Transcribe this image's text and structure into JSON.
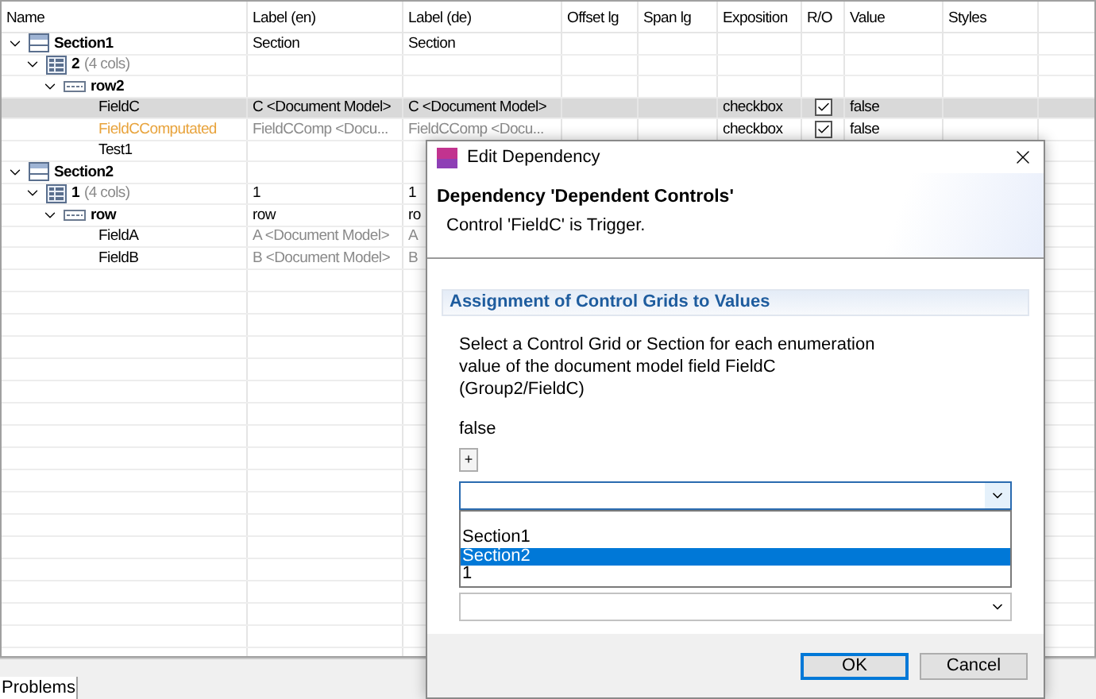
{
  "table": {
    "columns": [
      "Name",
      "Label (en)",
      "Label (de)",
      "Offset lg",
      "Span lg",
      "Exposition",
      "R/O",
      "Value",
      "Styles"
    ],
    "rows": [
      {
        "kind": "section",
        "name": "Section1",
        "expanded": true,
        "selected": false,
        "label_en": "Section",
        "label_de": "Section",
        "children": [
          {
            "kind": "grid",
            "name": "2",
            "count": "(4 cols)",
            "expanded": true,
            "selected": false,
            "children": [
              {
                "kind": "row",
                "name": "row2",
                "expanded": true,
                "selected": false,
                "children": [
                  {
                    "kind": "field",
                    "name": "FieldC",
                    "computed": false,
                    "selected": true,
                    "label_en": "C <Document Model>",
                    "label_de": "C <Document Model>",
                    "exposition": "checkbox",
                    "read_only": true,
                    "value": "false"
                  },
                  {
                    "kind": "field",
                    "name": "FieldCComputated",
                    "computed": true,
                    "selected": false,
                    "label_en": "FieldCComp <Docu...",
                    "label_de": "FieldCComp <Docu...",
                    "exposition": "checkbox",
                    "read_only": true,
                    "value": "false"
                  },
                  {
                    "kind": "field",
                    "name": "Test1",
                    "computed": false,
                    "selected": false
                  }
                ]
              }
            ]
          }
        ]
      },
      {
        "kind": "section",
        "name": "Section2",
        "expanded": true,
        "selected": false,
        "children": [
          {
            "kind": "grid",
            "name": "1",
            "count": "(4 cols)",
            "expanded": true,
            "selected": false,
            "label_en": "1",
            "label_de": "1",
            "children": [
              {
                "kind": "row",
                "name": "row",
                "expanded": true,
                "selected": false,
                "label_en": "row",
                "label_de": "ro",
                "children": [
                  {
                    "kind": "field",
                    "name": "FieldA",
                    "computed": false,
                    "selected": false,
                    "label_en": "A <Document Model>",
                    "label_de": "A"
                  },
                  {
                    "kind": "field",
                    "name": "FieldB",
                    "computed": false,
                    "selected": false,
                    "label_en": "B <Document Model>",
                    "label_de": "B"
                  }
                ]
              }
            ]
          }
        ]
      }
    ]
  },
  "bottom_tabs": [
    {
      "label": "Problems",
      "selected": true
    }
  ],
  "dialog": {
    "title": "Edit Dependency",
    "heading": "Dependency 'Dependent Controls'",
    "message": "Control 'FieldC' is Trigger.",
    "section_title": "Assignment of Control Grids to Values",
    "description": "Select a Control Grid or Section for each enumeration value of the document model field FieldC (Group2/FieldC)",
    "enum_label": "false",
    "add_button": "+",
    "options": [
      {
        "label": "Section1",
        "selected": false
      },
      {
        "label": "Section2",
        "selected": true
      },
      {
        "label": "1",
        "selected": false
      }
    ],
    "buttons": [
      {
        "label": "OK",
        "default": true
      },
      {
        "label": "Cancel",
        "default": false
      }
    ]
  }
}
